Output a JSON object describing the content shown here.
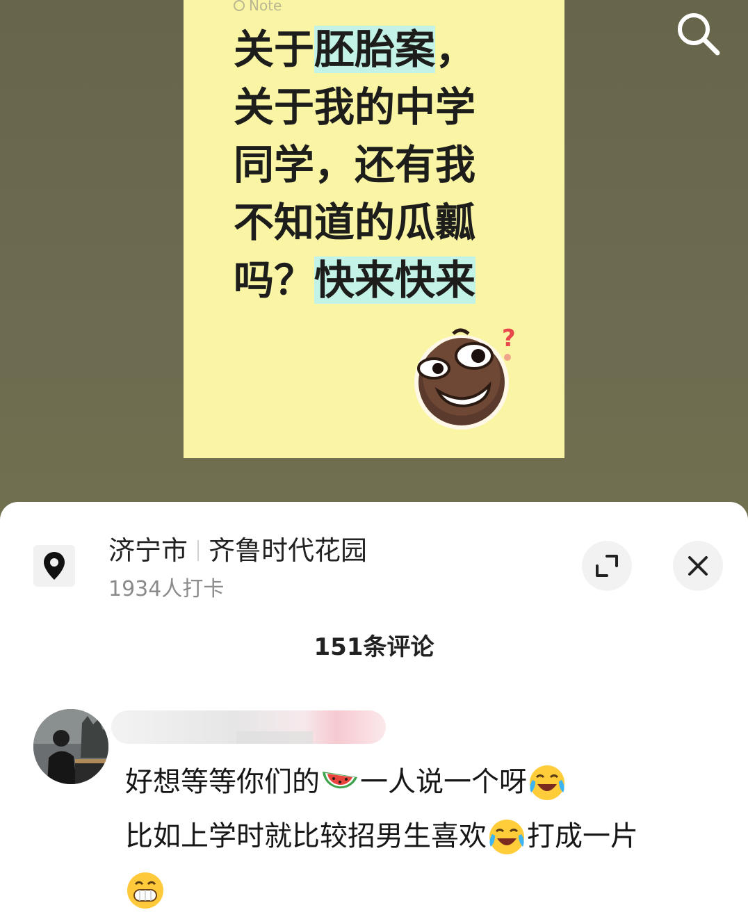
{
  "note": {
    "tag_label": "Note",
    "line_1_a": "关于",
    "line_1_highlight": "胚胎案",
    "line_1_b": "，",
    "line_2": "关于我的中学",
    "line_3": "同学，还有我",
    "line_4": "不知道的瓜瓤",
    "line_5_a": "吗？",
    "line_5_highlight": "快来快来"
  },
  "location": {
    "city": "济宁市",
    "place": "齐鲁时代花园",
    "checkins": "1934人打卡"
  },
  "comments": {
    "count_label": "151条评论",
    "items": [
      {
        "line_1_a": "好想等等你们的",
        "line_1_b": "一人说一个呀",
        "line_2_a": "比如上学时就比较招男生喜欢",
        "line_2_b": "打成一片"
      }
    ]
  },
  "icons": {
    "search": "search-icon",
    "location": "location-pin-icon",
    "expand": "expand-icon",
    "close": "close-icon",
    "watermelon": "watermelon-emoji",
    "laugh_cry": "laughing-crying-emoji",
    "grin": "grinning-emoji",
    "sticker": "thinking-grin-sticker"
  },
  "colors": {
    "note_background": "#f9f5a5",
    "highlight": "#c3f2e6",
    "video_background": "#6b6a4e"
  }
}
